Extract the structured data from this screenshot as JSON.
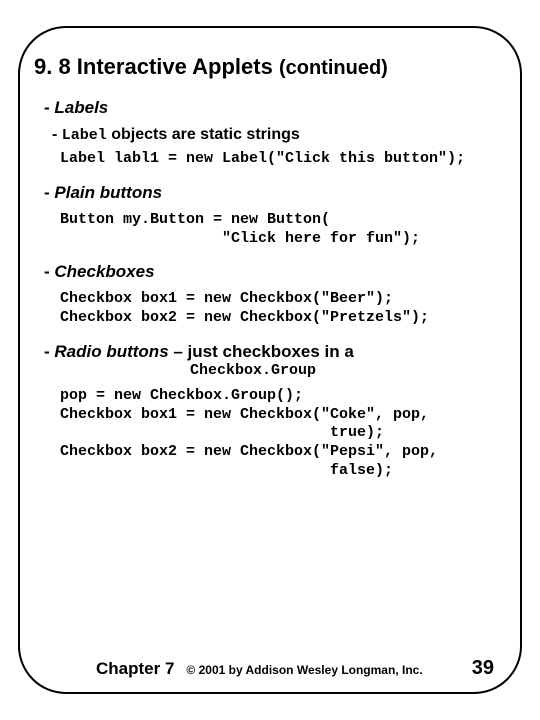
{
  "title": {
    "main": "9. 8 Interactive Applets ",
    "cont": "(continued)"
  },
  "sections": {
    "labels": {
      "heading": "Labels",
      "sub_prefix": "- ",
      "sub_code": "Label",
      "sub_rest": " objects are static strings",
      "code": "Label labl1 = new Label(\"Click this button\");"
    },
    "plain_buttons": {
      "heading": "Plain buttons",
      "code": "Button my.Button = new Button(\n                  \"Click here for fun\");"
    },
    "checkboxes": {
      "heading": "Checkboxes",
      "code": "Checkbox box1 = new Checkbox(\"Beer\");\nCheckbox box2 = new Checkbox(\"Pretzels\");"
    },
    "radio": {
      "heading_part1": "Radio buttons",
      "heading_part2": " – just checkboxes in a",
      "sub": "Checkbox.Group",
      "code": "pop = new Checkbox.Group();\nCheckbox box1 = new Checkbox(\"Coke\", pop,\n                              true);\nCheckbox box2 = new Checkbox(\"Pepsi\", pop,\n                              false);"
    }
  },
  "footer": {
    "chapter": "Chapter 7",
    "copyright": "© 2001 by Addison Wesley Longman, Inc.",
    "page": "39"
  }
}
